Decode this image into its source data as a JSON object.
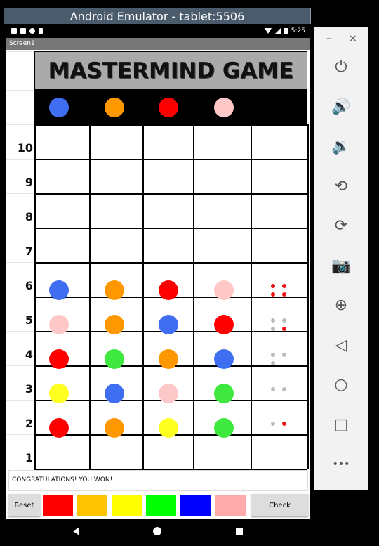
{
  "window": {
    "title": "Android Emulator - tablet:5506"
  },
  "status_bar": {
    "time": "5:25"
  },
  "app": {
    "screen_title": "Screen1",
    "game_title": "MASTERMIND GAME",
    "row_numbers": [
      "10",
      "9",
      "8",
      "7",
      "6",
      "5",
      "4",
      "3",
      "2",
      "1"
    ],
    "secret_code": [
      "#3f6ef0",
      "#ff9800",
      "#ff0000",
      "#ffc8c8"
    ],
    "guesses": [
      {
        "row": "6",
        "pegs": [
          "#3f6ef0",
          "#ff9800",
          "#ff0000",
          "#ffc8c8"
        ],
        "feedback": [
          "#ee1111",
          "#ee1111",
          "#ee1111",
          "#ee1111"
        ]
      },
      {
        "row": "5",
        "pegs": [
          "#ffc8c8",
          "#ff9800",
          "#3f6ef0",
          "#ff0000"
        ],
        "feedback": [
          "#bbbbbb",
          "#bbbbbb",
          "#bbbbbb",
          "#ee1111"
        ]
      },
      {
        "row": "4",
        "pegs": [
          "#ff0000",
          "#3ee83e",
          "#ff9800",
          "#3f6ef0"
        ],
        "feedback": [
          "#bbbbbb",
          "#bbbbbb",
          "#bbbbbb"
        ]
      },
      {
        "row": "3",
        "pegs": [
          "#ffff22",
          "#3f6ef0",
          "#ffc8c8",
          "#3ee83e"
        ],
        "feedback": [
          "#bbbbbb",
          "#bbbbbb"
        ]
      },
      {
        "row": "2",
        "pegs": [
          "#ff0000",
          "#ff9800",
          "#ffff22",
          "#3ee83e"
        ],
        "feedback": [
          "#bbbbbb",
          "#ee1111"
        ]
      }
    ],
    "message": "CONGRATULATIONS! YOU WON!",
    "reset_label": "Reset",
    "check_label": "Check",
    "palette": [
      "#ff0000",
      "#ffc400",
      "#ffff00",
      "#00ff00",
      "#0000ff",
      "#ffaaaa"
    ]
  },
  "side_panel": {
    "minimize": "–",
    "close": "×",
    "icons": [
      "power-icon",
      "volume-up-icon",
      "volume-down-icon",
      "rotate-left-icon",
      "rotate-right-icon",
      "camera-icon",
      "zoom-icon",
      "back-icon",
      "home-icon",
      "overview-icon",
      "more-icon"
    ]
  }
}
